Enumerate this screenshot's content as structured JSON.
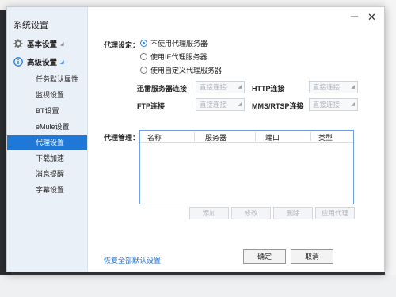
{
  "window": {
    "title": "系统设置"
  },
  "titlebar": {
    "minimize": "－",
    "close": "✕"
  },
  "sidebar": {
    "categories": [
      {
        "label": "基本设置"
      },
      {
        "label": "高级设置"
      }
    ],
    "items": [
      {
        "label": "任务默认属性"
      },
      {
        "label": "监视设置"
      },
      {
        "label": "BT设置"
      },
      {
        "label": "eMule设置"
      },
      {
        "label": "代理设置"
      },
      {
        "label": "下载加速"
      },
      {
        "label": "消息提醒"
      },
      {
        "label": "字幕设置"
      }
    ]
  },
  "proxy": {
    "label": "代理设定：",
    "options": [
      {
        "label": "不使用代理服务器",
        "checked": true
      },
      {
        "label": "使用IE代理服务器",
        "checked": false
      },
      {
        "label": "使用自定义代理服务器",
        "checked": false
      }
    ],
    "fields": {
      "xunlei": {
        "label": "迅雷服务器连接",
        "value": "直接连接"
      },
      "http": {
        "label": "HTTP连接",
        "value": "直接连接"
      },
      "ftp": {
        "label": "FTP连接",
        "value": "直接连接"
      },
      "mms": {
        "label": "MMS/RTSP连接",
        "value": "直接连接"
      }
    }
  },
  "manage": {
    "label": "代理管理：",
    "columns": [
      "名称",
      "服务器",
      "端口",
      "类型"
    ],
    "rows": []
  },
  "actions": {
    "add": "添加",
    "edit": "修改",
    "delete": "删除",
    "apply": "应用代理"
  },
  "footer": {
    "restore": "恢复全部默认设置",
    "ok": "确定",
    "cancel": "取消"
  },
  "colors": {
    "accent": "#1f78d8",
    "link": "#1f6fcf"
  }
}
